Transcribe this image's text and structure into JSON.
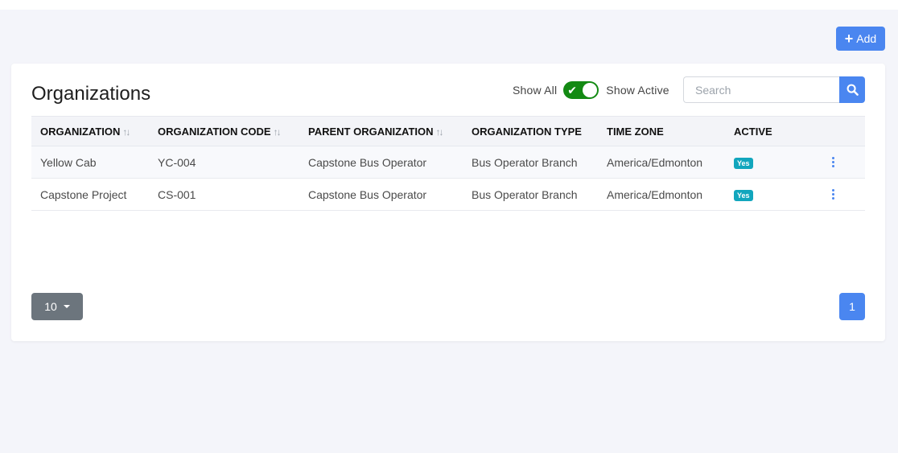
{
  "toolbar": {
    "add_label": "Add"
  },
  "card": {
    "title": "Organizations",
    "show_all_label": "Show All",
    "show_active_label": "Show Active",
    "toggle_on": true,
    "search": {
      "placeholder": "Search",
      "value": ""
    }
  },
  "table": {
    "columns": [
      "ORGANIZATION",
      "ORGANIZATION CODE",
      "PARENT ORGANIZATION",
      "ORGANIZATION TYPE",
      "TIME ZONE",
      "ACTIVE"
    ],
    "rows": [
      {
        "organization": "Yellow Cab",
        "code": "YC-004",
        "parent": "Capstone Bus Operator",
        "type": "Bus Operator Branch",
        "timezone": "America/Edmonton",
        "active": "Yes"
      },
      {
        "organization": "Capstone Project",
        "code": "CS-001",
        "parent": "Capstone Bus Operator",
        "type": "Bus Operator Branch",
        "timezone": "America/Edmonton",
        "active": "Yes"
      }
    ]
  },
  "pagination": {
    "page_size": "10",
    "current_page": "1"
  },
  "colors": {
    "accent": "#4a86f0",
    "toggle": "#138a13",
    "badge": "#12a6bd",
    "muted_button": "#6c757d"
  }
}
